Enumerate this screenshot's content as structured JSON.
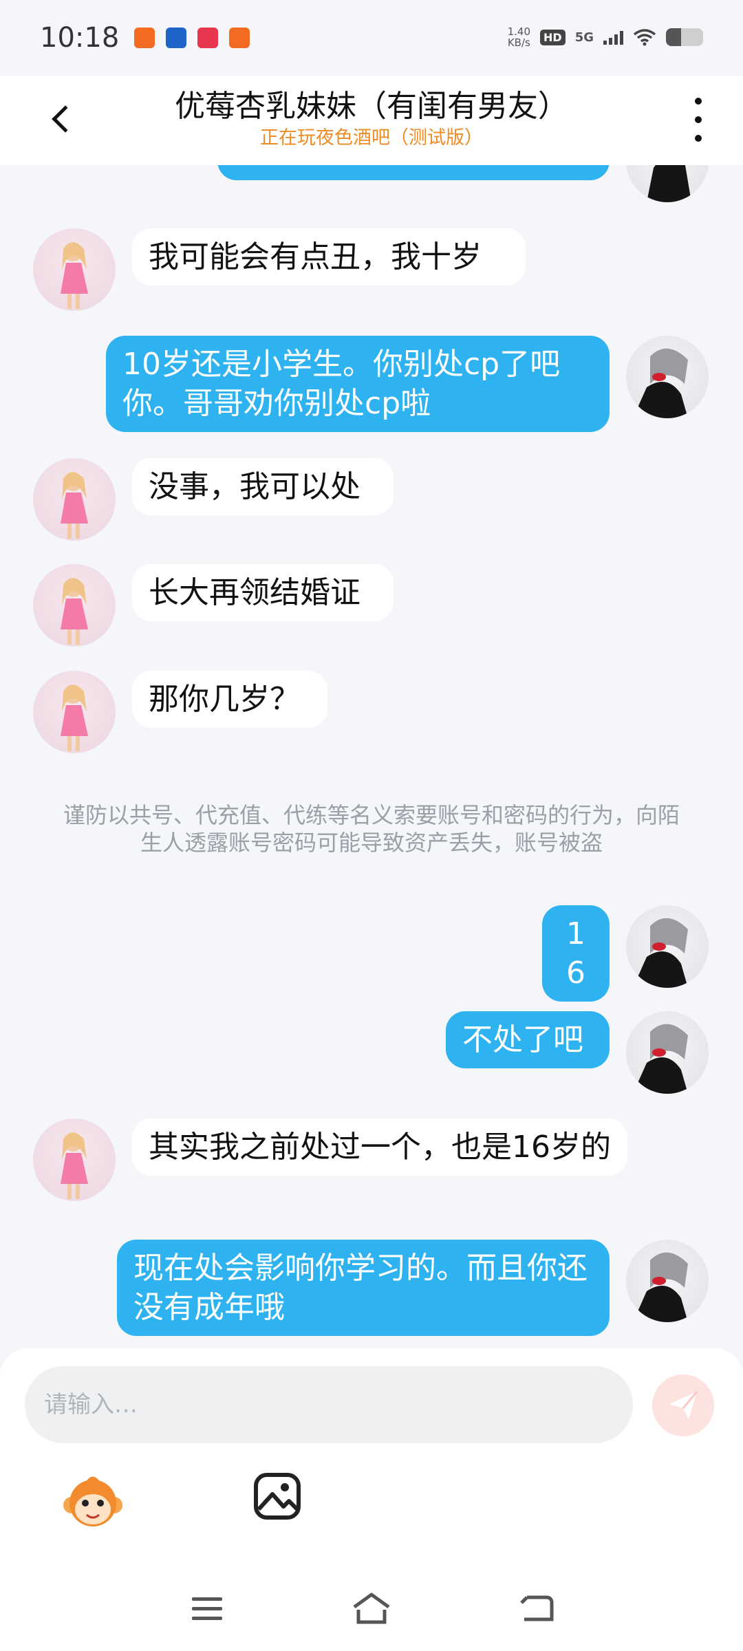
{
  "status_bar": {
    "time": "10:18",
    "net_speed_value": "1.40",
    "net_speed_unit": "KB/s",
    "hd_label": "HD",
    "network_label": "5G",
    "app_icon_colors": [
      "#f36b21",
      "#1e64c8",
      "#e8364f",
      "#f36b21"
    ]
  },
  "header": {
    "title": "优莓杏乳妹妹（有闺有男友）",
    "subtitle": "正在玩夜色酒吧（测试版）",
    "back_icon": "chevron-left-icon",
    "more_icon": "more-vertical-icon"
  },
  "messages": [
    {
      "side": "out",
      "text": ""
    },
    {
      "side": "in",
      "text": "我可能会有点丑，我十岁"
    },
    {
      "side": "out",
      "text": "10岁还是小学生。你别处cp了吧你。哥哥劝你别处cp啦"
    },
    {
      "side": "in",
      "text": "没事，我可以处"
    },
    {
      "side": "in",
      "text": "长大再领结婚证"
    },
    {
      "side": "in",
      "text": "那你几岁？"
    },
    {
      "side": "out",
      "text": "16"
    },
    {
      "side": "out",
      "text": "不处了吧"
    },
    {
      "side": "in",
      "text": "其实我之前处过一个，也是16岁的"
    },
    {
      "side": "out",
      "text": "现在处会影响你学习的。而且你还没有成年哦"
    }
  ],
  "security_notice": "谨防以共号、代充值、代练等名义索要账号和密码的行为，向陌生人透露账号密码可能导致资产丢失，账号被盗",
  "composer": {
    "placeholder": "请输入…",
    "send_icon": "paper-plane-icon",
    "emoji_icon": "monkey-emoji-icon",
    "image_icon": "image-icon"
  },
  "nav_bar": {
    "menu_icon": "menu-icon",
    "home_icon": "home-icon",
    "back_icon": "back-icon"
  },
  "colors": {
    "accent_bubble": "#2fb3f0",
    "subtitle": "#f08c24",
    "background": "#f4f6f9",
    "send_button": "#fde3e0"
  }
}
